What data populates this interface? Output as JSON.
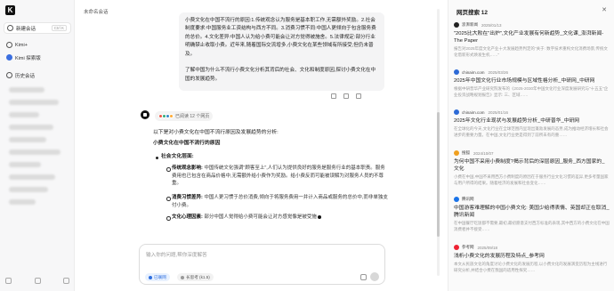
{
  "app": {
    "logo_letter": "K"
  },
  "sidebar": {
    "new_chat_label": "新建会话",
    "new_chat_shortcut": "Ctrl K",
    "items": [
      {
        "label": "Kimi+"
      },
      {
        "label": "Kimi 探索版"
      },
      {
        "label": "历史会话"
      }
    ]
  },
  "header": {
    "title": "未命名会话"
  },
  "user_message": {
    "text": "小费文化在中国不流行的原因:1.传统观念认为服务是基本职工作,无需额外奖励。2.社会制度要求:中国服务业工资结构与西方不同。3.消费习惯不同:中国人更倾向于包含服务费的总价。4.文化差异:中国人认为给小费可能会让对方觉得被施舍。5.法律规定:部分行业明确禁止收取小费。近年来,随着国际交流增多,小费文化在某些领域有所接受,但仍未普及。\n\n了解中国为什么不流行小费文化分析其背后的社会、文化和制度原因,探讨小费文化在中国的发展趋势。"
  },
  "ai_message": {
    "search_chip": "已阅读 12 个网页",
    "intro": "以下是对小费文化在中国不流行原因及发展趋势的分析:",
    "heading": "小费文化在中国不流行的原因",
    "section": "社会文化层面:",
    "points": [
      {
        "title": "传统观念影响:",
        "text": "中国传统文化强调\"顾客至上\",人们认为提供良好的服务是服务行业的基本职责。服务费用也已包含在商品价格中,无需额外给小费作为奖励。给小费反而可能被误解为对服务人员的不尊重。"
      },
      {
        "title": "消费习惯差异:",
        "text": "中国人更习惯于总价消费,倾向于将服务费用一并计入商品或服务的总价中,而非单独支付小费。"
      },
      {
        "title": "文化心理因素:",
        "text": "部分中国人觉得给小费可能会让对方感觉像是被受施"
      }
    ]
  },
  "input": {
    "placeholder": "输入你的问题,帮你深度解答",
    "search_pill": "已联网",
    "think_pill": "长思考 (k1.5)"
  },
  "right_panel": {
    "title": "网页搜索 12",
    "results": [
      {
        "source": "澎湃新闻",
        "date": "2025/01/13",
        "title": "\"2025比大败在\"出炉\",文化产业发展有何新趋势_文化课_澎湃新闻-The Paper",
        "snippet": "报告对2025年度文化产业十大发展趋势判定的\"关于: 数字技术重构文化消费场景,传统文化借新形式焕发生机……\""
      },
      {
        "source": "chinairn.com",
        "date": "2025/03/26",
        "title": "2025年中国文化行业市场规模与区域性格分析_中研网_中研网",
        "snippet": "根据中研普华产业研究院发布的《2025-2030年中国文化行业深度发展研究与\"十五五\"企业投资战略规划报告》显示: 三、区域……"
      },
      {
        "source": "chinairn.com",
        "date": "2025/01/16",
        "title": "2025年文化行业现状与发展趋势分析_中研普华_中研网",
        "snippet": "在全球化的今天,文化行业在全球范围内呈现出蓬勃发展的态势,成为推动经济增长和社会进步的重要力量。在中国,文化行业更是得到了前所未有的重……"
      },
      {
        "source": "搜狐",
        "date": "2024/10/07",
        "title": "为何中国不采用小费制度?揭示背后的深层原因_服务_西方国家的_文化",
        "snippet": "小费在中国,中国不采用西方小费制度的原因在于服务行业文化习惯的差异,更多考量国家与用户所得的结果。随着经济的发展和社会变化……"
      },
      {
        "source": "腾讯网",
        "date": "",
        "title": "中国游客难理解的中国小费文化: 美国少给得表情、英国却正在取消_腾讯新闻",
        "snippet": "在中国餐厅吃饭都不需要,最初,最初愿意支付西方标准的表现,其中西方的小费文化在中国消费者并不接受……"
      },
      {
        "source": "参考网",
        "date": "2025/09/18",
        "title": "浅析小费文化的发展历程及特点_参考网",
        "snippet": "本文从民族文化的角度讨论小费文化的发展历程,以小费文化的发展演变历程为主线进行研究分析,并结合小费在我国的适用性探究……"
      }
    ]
  },
  "colors": {
    "accent": "#2f6fe0",
    "user_bubble": "#f4f4f5",
    "panel_bg": "#fafafa"
  }
}
